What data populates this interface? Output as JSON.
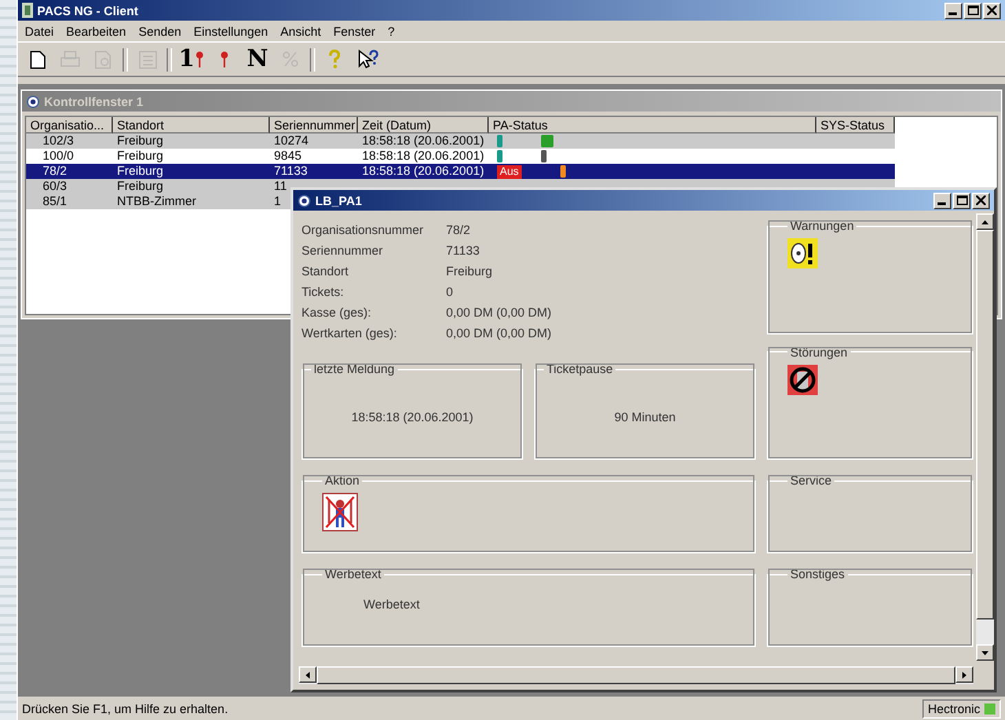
{
  "window": {
    "title": "PACS NG - Client"
  },
  "menu": [
    "Datei",
    "Bearbeiten",
    "Senden",
    "Einstellungen",
    "Ansicht",
    "Fenster",
    "?"
  ],
  "toolbar": [
    {
      "kind": "new",
      "disabled": false
    },
    {
      "kind": "print",
      "disabled": true
    },
    {
      "kind": "preview",
      "disabled": true
    },
    {
      "kind": "separator"
    },
    {
      "kind": "list",
      "disabled": true
    },
    {
      "kind": "separator"
    },
    {
      "kind": "pin-number",
      "text": "1",
      "disabled": false
    },
    {
      "kind": "pin-card",
      "disabled": false
    },
    {
      "kind": "letter",
      "text": "N",
      "disabled": false
    },
    {
      "kind": "percent",
      "disabled": true
    },
    {
      "kind": "separator"
    },
    {
      "kind": "help",
      "disabled": false
    },
    {
      "kind": "context-help",
      "disabled": false
    }
  ],
  "child_window": {
    "title": "Kontrollfenster 1",
    "active": false
  },
  "table": {
    "columns": [
      "Organisatio...",
      "Standort",
      "Seriennummer",
      "Zeit (Datum)",
      "PA-Status",
      "SYS-Status"
    ],
    "rows": [
      {
        "org": "102/3",
        "location": "Freiburg",
        "serial": "10274",
        "time": "18:58:18 (20.06.2001)",
        "pa_status": [
          {
            "color": "#1a9a8a"
          },
          {
            "color": "#2aa02a",
            "wide": true
          }
        ],
        "shaded": true,
        "selected": false
      },
      {
        "org": "100/0",
        "location": "Freiburg",
        "serial": "9845",
        "time": "18:58:18 (20.06.2001)",
        "pa_status": [
          {
            "color": "#1a9a8a"
          },
          {
            "color": "#555555"
          }
        ],
        "shaded": false,
        "selected": false
      },
      {
        "org": "78/2",
        "location": "Freiburg",
        "serial": "71133",
        "time": "18:58:18 (20.06.2001)",
        "pa_status": [
          {
            "color": "#e02020",
            "text": "Aus"
          },
          {
            "color": "#f08a20"
          }
        ],
        "shaded": false,
        "selected": true
      },
      {
        "org": "60/3",
        "location": "Freiburg",
        "serial": "11",
        "pa_status": [],
        "shaded": true,
        "selected": false
      },
      {
        "org": "85/1",
        "location": "NTBB-Zimmer",
        "serial": "1",
        "pa_status": [],
        "shaded": true,
        "selected": false
      }
    ]
  },
  "dialog": {
    "title": "LB_PA1",
    "fields": [
      {
        "label": "Organisationsnummer",
        "value": "78/2"
      },
      {
        "label": "Seriennummer",
        "value": "71133"
      },
      {
        "label": "Standort",
        "value": "Freiburg"
      },
      {
        "label": "Tickets:",
        "value": "0"
      },
      {
        "label": "Kasse (ges):",
        "value": "0,00 DM (0,00 DM)"
      },
      {
        "label": "Wertkarten (ges):",
        "value": "0,00 DM (0,00 DM)"
      }
    ],
    "last_message": {
      "title": "letzte Meldung",
      "text": "18:58:18 (20.06.2001)"
    },
    "ticket_pause": {
      "title": "Ticketpause",
      "text": "90 Minuten"
    },
    "warnings": {
      "title": "Warnungen",
      "kind": "warning"
    },
    "faults": {
      "title": "Störungen",
      "kind": "fault"
    },
    "action": {
      "title": "Aktion",
      "kind": "action"
    },
    "service": {
      "title": "Service"
    },
    "ad_text": {
      "title": "Werbetext",
      "text": "Werbetext"
    },
    "misc": {
      "title": "Sonstiges"
    }
  },
  "status_bar": {
    "message": "Drücken Sie F1, um Hilfe zu erhalten.",
    "company": "Hectronic"
  }
}
